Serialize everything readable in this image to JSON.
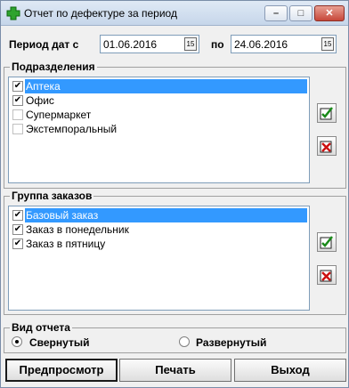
{
  "window": {
    "title": "Отчет по дефектуре за период",
    "controls": {
      "minimize": "–",
      "maximize": "□",
      "close": "✕"
    }
  },
  "period": {
    "label": "Период дат с",
    "from": "01.06.2016",
    "to_label": "по",
    "to": "24.06.2016",
    "calendar_glyph": "15"
  },
  "departments": {
    "title": "Подразделения",
    "items": [
      {
        "label": "Аптека",
        "checked": true,
        "selected": true
      },
      {
        "label": "Офис",
        "checked": true,
        "selected": false
      },
      {
        "label": "Супермаркет",
        "checked": false,
        "selected": false
      },
      {
        "label": "Экстемпоральный",
        "checked": false,
        "selected": false
      }
    ]
  },
  "order_groups": {
    "title": "Группа заказов",
    "items": [
      {
        "label": "Базовый заказ",
        "checked": true,
        "selected": true
      },
      {
        "label": "Заказ в понедельник",
        "checked": true,
        "selected": false
      },
      {
        "label": "Заказ в пятницу",
        "checked": true,
        "selected": false
      }
    ]
  },
  "report_type": {
    "title": "Вид отчета",
    "options": [
      {
        "label": "Свернутый",
        "selected": true
      },
      {
        "label": "Развернутый",
        "selected": false
      }
    ]
  },
  "buttons": {
    "preview": "Предпросмотр",
    "print": "Печать",
    "exit": "Выход"
  },
  "icons": {
    "app": "green-cross-icon",
    "select_all": "check-all-icon",
    "clear_all": "uncheck-all-icon"
  },
  "colors": {
    "selection": "#3399ff",
    "check_all_green": "#1a8a1a",
    "clear_all_red": "#cc1010"
  }
}
